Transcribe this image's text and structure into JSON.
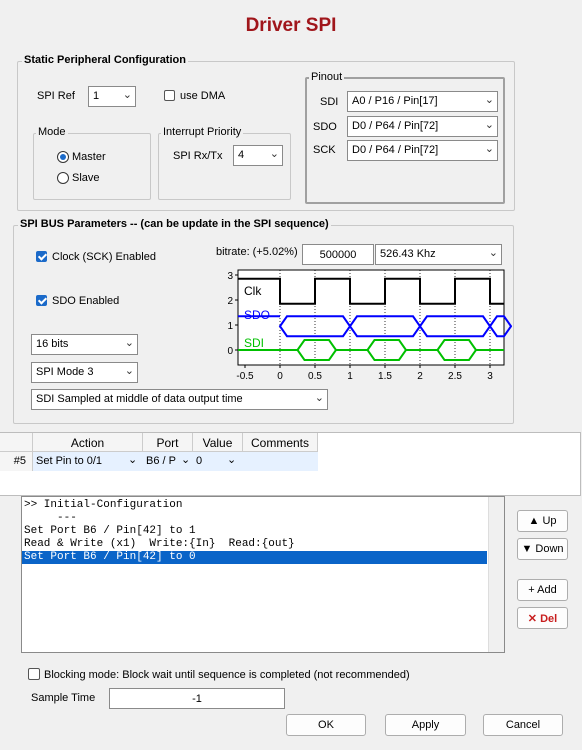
{
  "title": "Driver SPI",
  "static_cfg": {
    "legend": "Static Peripheral Configuration",
    "spi_ref_label": "SPI Ref",
    "spi_ref_value": "1",
    "use_dma_label": "use DMA",
    "mode_legend": "Mode",
    "mode_master": "Master",
    "mode_slave": "Slave",
    "irq_legend": "Interrupt Priority",
    "irq_label": "SPI Rx/Tx",
    "irq_value": "4",
    "pinout_legend": "Pinout",
    "sdi_label": "SDI",
    "sdi_value": "A0 / P16 / Pin[17]",
    "sdo_label": "SDO",
    "sdo_value": "D0 / P64 / Pin[72]",
    "sck_label": "SCK",
    "sck_value": "D0 / P64 / Pin[72]"
  },
  "bus": {
    "legend": "SPI BUS Parameters  --  (can be update in the SPI sequence)",
    "clock_label": "Clock (SCK) Enabled",
    "sdo_label": "SDO Enabled",
    "bitrate_label": "bitrate: (+5.02%)",
    "bitrate_value": "500000",
    "bitrate_actual": "526.43 Khz",
    "bits_value": "16 bits",
    "mode_value": "SPI Mode 3",
    "sampled_value": "SDI Sampled at middle of data output time"
  },
  "chart_data": {
    "type": "line",
    "series": [
      {
        "name": "Clk",
        "color": "#000000"
      },
      {
        "name": "SDO",
        "color": "#0000ff"
      },
      {
        "name": "SDI",
        "color": "#00c000"
      }
    ],
    "xlim": [
      -0.6,
      3.2
    ],
    "xticks": [
      "-0.5",
      "0",
      "0.5",
      "1",
      "1.5",
      "2",
      "2.5",
      "3"
    ],
    "ylim": [
      -0.6,
      3.2
    ],
    "yticks": [
      "0",
      "1",
      "2",
      "3"
    ]
  },
  "table": {
    "headers": [
      "Action",
      "Port",
      "Value",
      "Comments"
    ],
    "rows": [
      {
        "index": "#5",
        "action": "Set Pin to 0/1",
        "port": "B6 / P",
        "value": "0",
        "comments": ""
      }
    ]
  },
  "sequence": {
    "lines": [
      ">> Initial-Configuration",
      "     ---",
      "Set Port B6 / Pin[42] to 1",
      "Read & Write (x1)  Write:{In}  Read:{out}",
      "Set Port B6 / Pin[42] to 0"
    ],
    "selected_index": 4
  },
  "side_buttons": {
    "up": "Up",
    "down": "Down",
    "add": "+ Add",
    "del": "Del"
  },
  "blocking_label": "Blocking mode: Block wait until sequence is completed (not recommended)",
  "sample_time_label": "Sample Time",
  "sample_time_value": "-1",
  "buttons": {
    "ok": "OK",
    "apply": "Apply",
    "cancel": "Cancel"
  }
}
